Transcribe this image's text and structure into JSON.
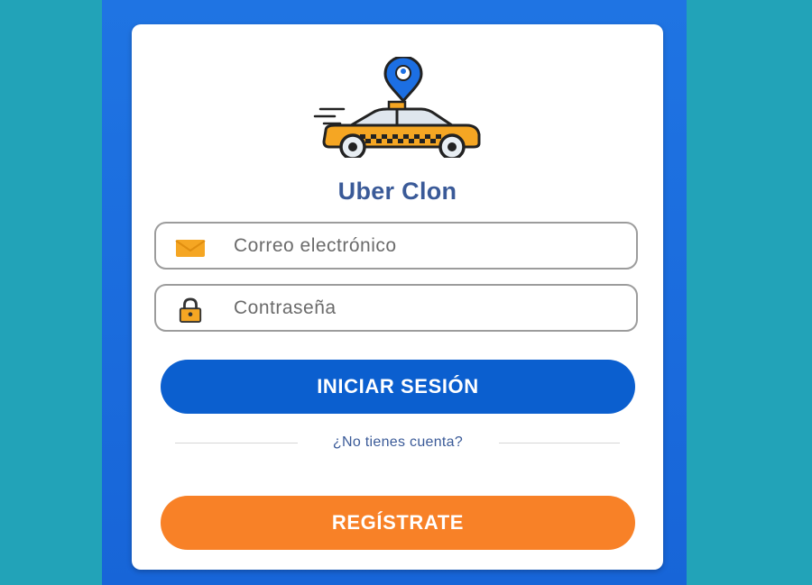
{
  "app": {
    "title": "Uber Clon",
    "logo_icon": "taxi-with-location-pin-icon"
  },
  "form": {
    "email": {
      "placeholder": "Correo electrónico",
      "value": "",
      "icon": "envelope-icon"
    },
    "password": {
      "placeholder": "Contraseña",
      "value": "",
      "icon": "padlock-icon"
    },
    "login_label": "INICIAR SESIÓN",
    "divider_text": "¿No tienes cuenta?",
    "register_label": "REGÍSTRATE"
  },
  "colors": {
    "background": "#22a3b8",
    "phone_background": "#1f74e3",
    "title": "#3a5a98",
    "login_button": "#0b5fcf",
    "register_button": "#f88127"
  }
}
